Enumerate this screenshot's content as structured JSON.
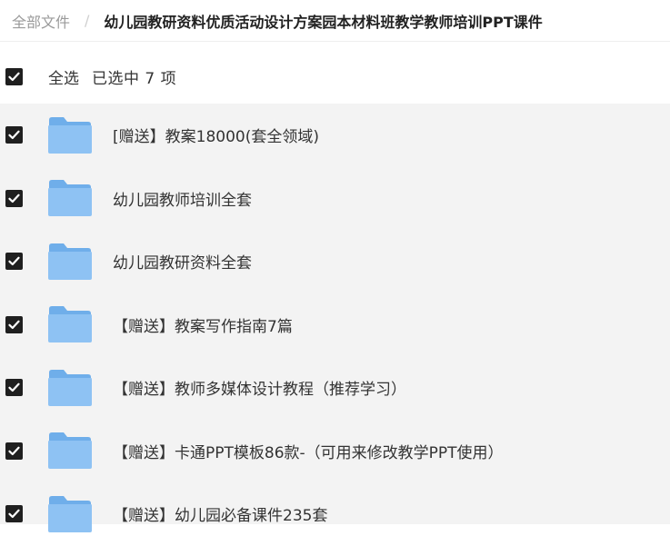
{
  "breadcrumb": {
    "root": "全部文件",
    "separator": "/",
    "current": "幼儿园教研资料优质活动设计方案园本材料班教学教师培训PPT课件"
  },
  "selection": {
    "select_all_label": "全选",
    "selected_text": "已选中 7 项",
    "checked": true
  },
  "files": [
    {
      "name": "[赠送】教案18000(套全领域)",
      "type": "folder",
      "checked": true
    },
    {
      "name": "幼儿园教师培训全套",
      "type": "folder",
      "checked": true
    },
    {
      "name": "幼儿园教研资料全套",
      "type": "folder",
      "checked": true
    },
    {
      "name": "【赠送】教案写作指南7篇",
      "type": "folder",
      "checked": true
    },
    {
      "name": "【赠送】教师多媒体设计教程（推荐学习）",
      "type": "folder",
      "checked": true
    },
    {
      "name": "【赠送】卡通PPT模板86款-（可用来修改教学PPT使用）",
      "type": "folder",
      "checked": true
    },
    {
      "name": "【赠送】幼儿园必备课件235套",
      "type": "folder",
      "checked": true
    }
  ],
  "colors": {
    "folder_body": "#8ec2f3",
    "folder_tab": "#6faeea",
    "checkbox_fill": "#1f1f1f",
    "list_background": "#f3f3f3"
  },
  "icons": {
    "checkbox": "checkbox-checked-icon",
    "folder": "folder-icon"
  }
}
